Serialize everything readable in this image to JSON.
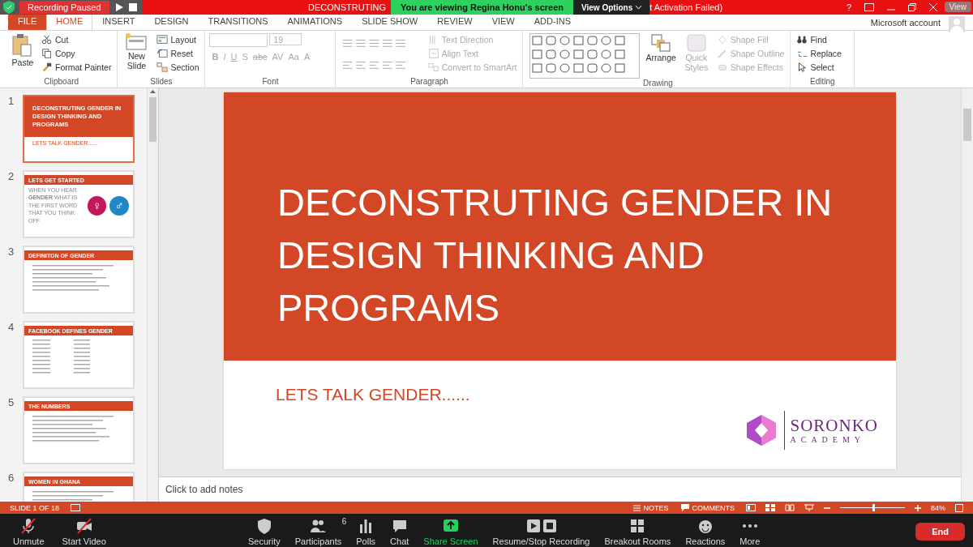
{
  "title_bar": {
    "title": "DECONSTRUTING",
    "title_suffix": "t Activation Failed)",
    "help": "?"
  },
  "recording": {
    "label": "Recording Paused"
  },
  "share_banner": {
    "label": "You are viewing Regina Honu's screen",
    "view_options": "View Options",
    "view": "View"
  },
  "ribbon_tabs": [
    {
      "label": "FILE",
      "kind": "file",
      "selected": false
    },
    {
      "label": "HOME",
      "kind": "tab",
      "selected": true
    },
    {
      "label": "INSERT",
      "kind": "tab",
      "selected": false
    },
    {
      "label": "DESIGN",
      "kind": "tab",
      "selected": false
    },
    {
      "label": "TRANSITIONS",
      "kind": "tab",
      "selected": false
    },
    {
      "label": "ANIMATIONS",
      "kind": "tab",
      "selected": false
    },
    {
      "label": "SLIDE SHOW",
      "kind": "tab",
      "selected": false
    },
    {
      "label": "REVIEW",
      "kind": "tab",
      "selected": false
    },
    {
      "label": "VIEW",
      "kind": "tab",
      "selected": false
    },
    {
      "label": "ADD-INS",
      "kind": "tab",
      "selected": false
    }
  ],
  "account": "Microsoft account",
  "clipboard": {
    "label": "Clipboard",
    "paste": "Paste",
    "commands": [
      {
        "label": "Cut",
        "kind": "cut",
        "disabled": false
      },
      {
        "label": "Copy",
        "kind": "copy",
        "disabled": false
      },
      {
        "label": "Format Painter",
        "kind": "brush",
        "disabled": false
      }
    ]
  },
  "slides_group": {
    "label": "Slides",
    "new_slide": "New Slide",
    "commands": [
      {
        "label": "Layout",
        "kind": "layout",
        "disabled": false
      },
      {
        "label": "Reset",
        "kind": "reset",
        "disabled": false
      },
      {
        "label": "Section",
        "kind": "section",
        "disabled": false
      }
    ]
  },
  "font": {
    "label": "Font",
    "size": "19",
    "disabled": true,
    "buttons": [
      "B",
      "I",
      "U",
      "S",
      "abc",
      "AV",
      "Aa",
      "A"
    ]
  },
  "paragraph": {
    "label": "Paragraph",
    "commands": [
      {
        "label": "Text Direction",
        "kind": "textdir",
        "disabled": true
      },
      {
        "label": "Align Text",
        "kind": "align",
        "disabled": true
      },
      {
        "label": "Convert to SmartArt",
        "kind": "smartart",
        "disabled": true
      }
    ]
  },
  "drawing": {
    "label": "Drawing",
    "arrange": "Arrange",
    "quick_styles": "Quick Styles",
    "quick_styles_disabled": true,
    "commands": [
      {
        "label": "Shape Fill",
        "kind": "fill",
        "disabled": true
      },
      {
        "label": "Shape Outline",
        "kind": "outline",
        "disabled": true
      },
      {
        "label": "Shape Effects",
        "kind": "effects",
        "disabled": true
      }
    ]
  },
  "editing": {
    "label": "Editing",
    "commands": [
      {
        "label": "Find",
        "kind": "find",
        "disabled": false
      },
      {
        "label": "Replace",
        "kind": "replace",
        "disabled": false
      },
      {
        "label": "Select",
        "kind": "select",
        "disabled": false
      }
    ]
  },
  "thumbnails": [
    {
      "number": "1",
      "kind": "title",
      "selected": true,
      "title": "DECONSTRUTING GENDER IN DESIGN THINKING AND PROGRAMS",
      "subtitle": "LETS TALK GENDER......"
    },
    {
      "number": "2",
      "kind": "symbols",
      "selected": false,
      "title": "LETS GET STARTED",
      "body": "WHEN YOU HEAR **GENDER** WHAT IS THE FIRST WORD THAT YOU THINK OFF",
      "symbols": [
        "♀",
        "♂"
      ]
    },
    {
      "number": "3",
      "kind": "text",
      "selected": false,
      "title": "DEFINITON OF GENDER"
    },
    {
      "number": "4",
      "kind": "list",
      "selected": false,
      "title": "FACEBOOK DEFINES GENDER"
    },
    {
      "number": "5",
      "kind": "text",
      "selected": false,
      "title": "THE NUMBERS"
    },
    {
      "number": "6",
      "kind": "text",
      "selected": false,
      "title": "WOMEN IN GHANA"
    }
  ],
  "slide": {
    "title": "DECONSTRUTING GENDER IN DESIGN THINKING AND PROGRAMS",
    "subtitle": "LETS TALK GENDER......",
    "logo_name": "SORONKO",
    "logo_tagline": "ACADEMY"
  },
  "notes": {
    "placeholder": "Click to add notes"
  },
  "status_bar": {
    "slide": "SLIDE 1 OF 18",
    "notes": "NOTES",
    "comments": "COMMENTS",
    "zoom": "84%",
    "zoom_slider": {
      "level": 0.5
    }
  },
  "meeting_toolbar": {
    "left": [
      {
        "label": "Unmute",
        "kind": "mic"
      },
      {
        "label": "Start Video",
        "kind": "video"
      }
    ],
    "center": [
      {
        "label": "Security",
        "kind": "shield"
      },
      {
        "label": "Participants",
        "kind": "people",
        "count": "6"
      },
      {
        "label": "Polls",
        "kind": "polls"
      },
      {
        "label": "Chat",
        "kind": "chat"
      },
      {
        "label": "Share Screen",
        "kind": "share"
      },
      {
        "label": "Resume/Stop Recording",
        "kind": "record"
      },
      {
        "label": "Breakout Rooms",
        "kind": "rooms"
      },
      {
        "label": "Reactions",
        "kind": "reactions"
      },
      {
        "label": "More",
        "kind": "more"
      }
    ],
    "end": "End"
  }
}
